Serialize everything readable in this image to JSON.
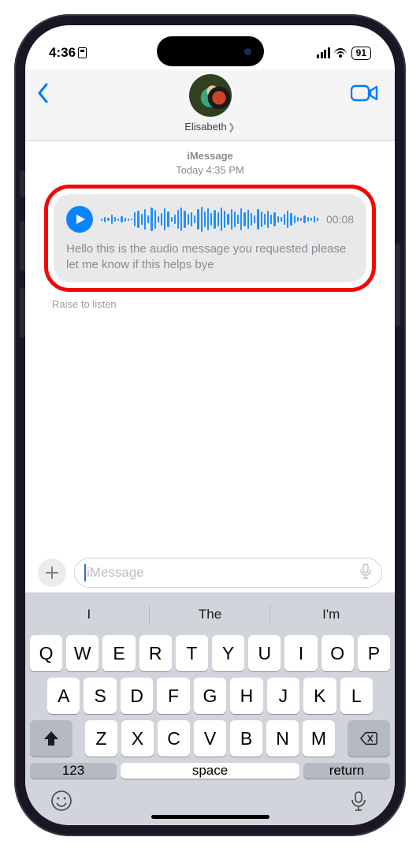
{
  "status": {
    "time": "4:36",
    "battery": "91"
  },
  "header": {
    "contact_name": "Elisabeth"
  },
  "thread": {
    "service": "iMessage",
    "date_label": "Today",
    "time_label": "4:35 PM",
    "audio_duration": "00:08",
    "transcript": "Hello this is the audio message you requested please let me know if this helps bye",
    "hint": "Raise to listen"
  },
  "compose": {
    "placeholder": "iMessage"
  },
  "keyboard": {
    "suggestions": [
      "I",
      "The",
      "I'm"
    ],
    "row1": [
      "Q",
      "W",
      "E",
      "R",
      "T",
      "Y",
      "U",
      "I",
      "O",
      "P"
    ],
    "row2": [
      "A",
      "S",
      "D",
      "F",
      "G",
      "H",
      "J",
      "K",
      "L"
    ],
    "row3": [
      "Z",
      "X",
      "C",
      "V",
      "B",
      "N",
      "M"
    ],
    "numkey": "123",
    "space": "space",
    "return": "return"
  },
  "waveform_heights": [
    3,
    7,
    4,
    12,
    6,
    3,
    8,
    5,
    3,
    2,
    18,
    22,
    14,
    26,
    10,
    30,
    24,
    8,
    16,
    28,
    20,
    6,
    12,
    24,
    30,
    22,
    14,
    18,
    10,
    26,
    32,
    20,
    28,
    16,
    24,
    18,
    30,
    22,
    14,
    26,
    20,
    12,
    28,
    18,
    24,
    16,
    10,
    26,
    20,
    14,
    22,
    12,
    18,
    8,
    6,
    14,
    22,
    16,
    10,
    6,
    4,
    10,
    6,
    4,
    8,
    4
  ]
}
